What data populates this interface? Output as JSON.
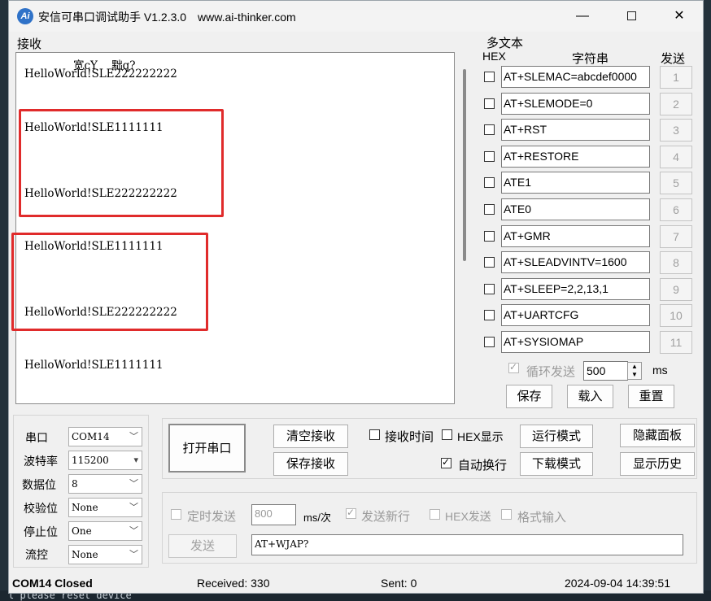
{
  "window": {
    "title": "安信可串口调试助手 V1.2.3.0",
    "url": "www.ai-thinker.com",
    "app_icon": "Ai",
    "minimize": "—",
    "close": "✕"
  },
  "receive": {
    "label": "接收",
    "garbled_line": "宽cY    黜q?",
    "lines": [
      "HelloWorld!SLE222222222",
      "HelloWorld!SLE1111111",
      "HelloWorld!SLE222222222",
      "HelloWorld!SLE1111111",
      "HelloWorld!SLE222222222",
      "HelloWorld!SLE1111111"
    ]
  },
  "multitext": {
    "label": "多文本",
    "col_hex": "HEX",
    "col_string": "字符串",
    "col_send": "发送",
    "commands": [
      {
        "text": "AT+SLEMAC=abcdef0000",
        "num": "1"
      },
      {
        "text": "AT+SLEMODE=0",
        "num": "2"
      },
      {
        "text": "AT+RST",
        "num": "3"
      },
      {
        "text": "AT+RESTORE",
        "num": "4"
      },
      {
        "text": "ATE1",
        "num": "5"
      },
      {
        "text": "ATE0",
        "num": "6"
      },
      {
        "text": "AT+GMR",
        "num": "7"
      },
      {
        "text": "AT+SLEADVINTV=1600",
        "num": "8"
      },
      {
        "text": "AT+SLEEP=2,2,13,1",
        "num": "9"
      },
      {
        "text": "AT+UARTCFG",
        "num": "10"
      },
      {
        "text": "AT+SYSIOMAP",
        "num": "11"
      }
    ],
    "loop_send": "循环发送",
    "loop_interval": "500",
    "unit_ms": "ms",
    "save": "保存",
    "load": "载入",
    "reset": "重置"
  },
  "serial": {
    "port_label": "串口",
    "port_value": "COM14",
    "baud_label": "波特率",
    "baud_value": "115200",
    "data_label": "数据位",
    "data_value": "8",
    "parity_label": "校验位",
    "parity_value": "None",
    "stop_label": "停止位",
    "stop_value": "One",
    "flow_label": "流控",
    "flow_value": "None"
  },
  "controls": {
    "open_port": "打开串口",
    "clear_recv": "清空接收",
    "save_recv": "保存接收",
    "recv_time": "接收时间",
    "hex_display": "HEX显示",
    "auto_wrap": "自动换行",
    "run_mode": "运行模式",
    "download_mode": "下载模式",
    "hide_panel": "隐藏面板",
    "show_history": "显示历史"
  },
  "send": {
    "timed_send": "定时发送",
    "interval": "800",
    "interval_unit": "ms/次",
    "send_newline": "发送新行",
    "hex_send": "HEX发送",
    "format_input": "格式输入",
    "send_button": "发送",
    "input_value": "AT+WJAP?"
  },
  "status": {
    "port_state": "COM14 Closed",
    "received": "Received: 330",
    "sent": "Sent: 0",
    "datetime": "2024-09-04 14:39:51"
  },
  "background": {
    "bottom_text": "l please reset device"
  }
}
